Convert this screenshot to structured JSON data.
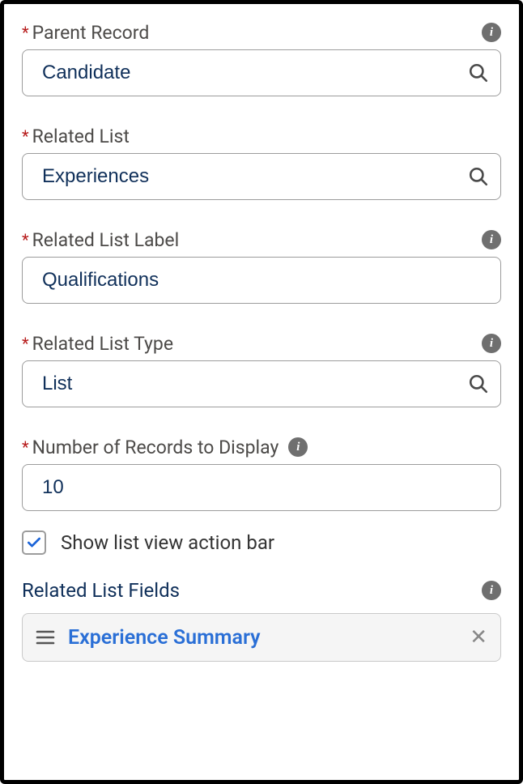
{
  "fields": {
    "parentRecord": {
      "label": "Parent Record",
      "value": "Candidate"
    },
    "relatedList": {
      "label": "Related List",
      "value": "Experiences"
    },
    "relatedListLabel": {
      "label": "Related List Label",
      "value": "Qualifications"
    },
    "relatedListType": {
      "label": "Related List Type",
      "value": "List"
    },
    "numRecords": {
      "label": "Number of Records to Display",
      "value": "10"
    },
    "showActionBar": {
      "label": "Show list view action bar",
      "checked": true
    }
  },
  "relatedListFields": {
    "title": "Related List Fields",
    "items": [
      {
        "label": "Experience Summary"
      }
    ]
  }
}
